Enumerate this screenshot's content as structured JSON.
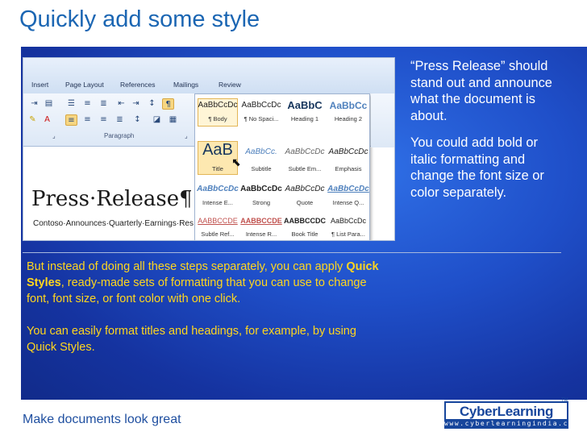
{
  "slide": {
    "title": "Quickly add some style",
    "footer": "Make documents look great"
  },
  "logo": {
    "name": "CyberLearning",
    "url": "www.cyberlearningindia.com",
    "tm": "TM"
  },
  "ribbon": {
    "tabs": [
      "Insert",
      "Page Layout",
      "References",
      "Mailings",
      "Review"
    ],
    "group_label": "Paragraph"
  },
  "styles_gallery": {
    "items": [
      {
        "preview": "AaBbCcDc",
        "name": "¶ Body"
      },
      {
        "preview": "AaBbCcDc",
        "name": "¶ No Spaci..."
      },
      {
        "preview": "AaBbC",
        "name": "Heading 1"
      },
      {
        "preview": "AaBbCc",
        "name": "Heading 2"
      },
      {
        "preview": "AaB",
        "name": "Title"
      },
      {
        "preview": "AaBbCc.",
        "name": "Subtitle"
      },
      {
        "preview": "AaBbCcDc",
        "name": "Subtle Em..."
      },
      {
        "preview": "AaBbCcDc",
        "name": "Emphasis"
      },
      {
        "preview": "AaBbCcDc",
        "name": "Intense E..."
      },
      {
        "preview": "AaBbCcDc",
        "name": "Strong"
      },
      {
        "preview": "AaBbCcDc",
        "name": "Quote"
      },
      {
        "preview": "AaBbCcDc",
        "name": "Intense Q..."
      },
      {
        "preview": "AABBCCDE",
        "name": "Subtle Ref..."
      },
      {
        "preview": "AABBCCDE",
        "name": "Intense R..."
      },
      {
        "preview": "AABBCCDC",
        "name": "Book Title"
      },
      {
        "preview": "AaBbCcDc",
        "name": "¶ List Para..."
      }
    ]
  },
  "document": {
    "heading": "Press·Release¶",
    "subtext": "Contoso·Announces·Quarterly·Earnings·Res"
  },
  "right_text": {
    "p1": "“Press Release” should stand out and announce what the document is about.",
    "p2": "You could add bold or italic formatting and change the font size or color separately."
  },
  "yellow_text": {
    "p1_before": "But instead of doing all these steps separately, you can apply ",
    "p1_bold": "Quick Styles",
    "p1_after": ", ready-made sets of formatting that you can use to change font, font size, or font color with one click.",
    "p2": "You can easily format titles and headings, for example, by using Quick Styles."
  },
  "colors": {
    "title": "#1b66b3",
    "panel": "#1f4fc9",
    "yellow": "#ffd61e",
    "logo": "#17469c"
  }
}
